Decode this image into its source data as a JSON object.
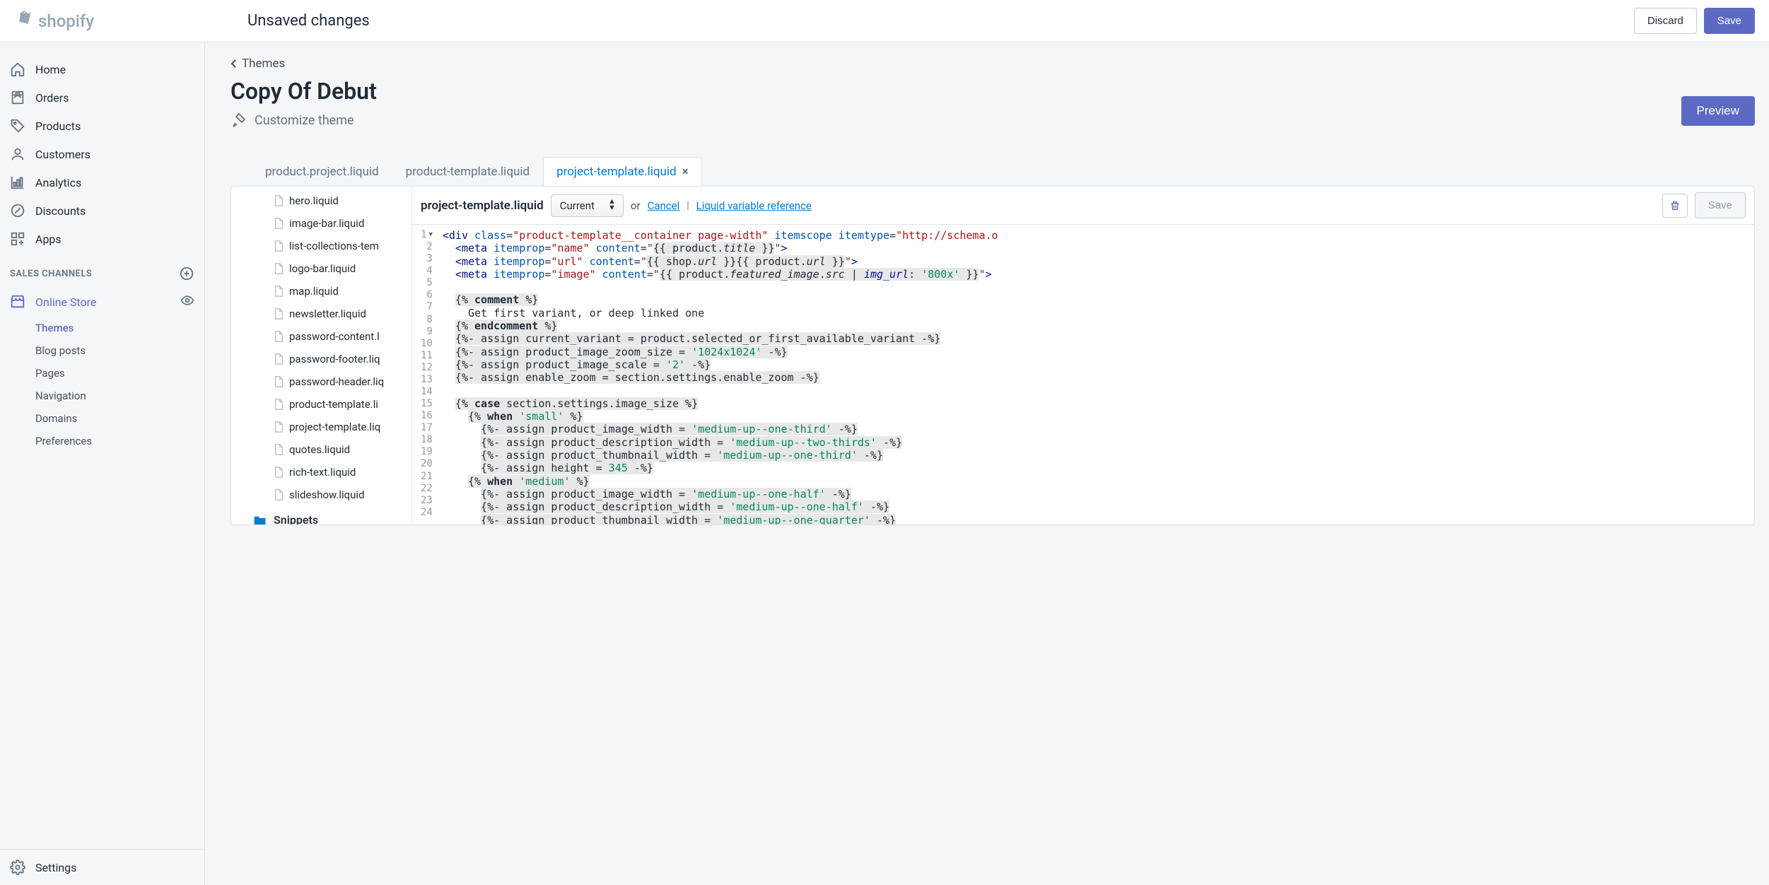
{
  "brand": "shopify",
  "topbar": {
    "unsaved": "Unsaved changes",
    "discard": "Discard",
    "save": "Save"
  },
  "nav": {
    "home": "Home",
    "orders": "Orders",
    "products": "Products",
    "customers": "Customers",
    "analytics": "Analytics",
    "discounts": "Discounts",
    "apps": "Apps",
    "section": "SALES CHANNELS",
    "online_store": "Online Store",
    "themes": "Themes",
    "blog": "Blog posts",
    "pages": "Pages",
    "navigation": "Navigation",
    "domains": "Domains",
    "preferences": "Preferences",
    "settings": "Settings"
  },
  "page": {
    "breadcrumb": "Themes",
    "title": "Copy Of Debut",
    "customize": "Customize theme",
    "preview": "Preview"
  },
  "tabs": [
    {
      "label": "product.project.liquid",
      "active": false
    },
    {
      "label": "product-template.liquid",
      "active": false
    },
    {
      "label": "project-template.liquid",
      "active": true
    }
  ],
  "files": [
    "hero.liquid",
    "image-bar.liquid",
    "list-collections-tem",
    "logo-bar.liquid",
    "map.liquid",
    "newsletter.liquid",
    "password-content.l",
    "password-footer.liq",
    "password-header.liq",
    "product-template.li",
    "project-template.liq",
    "quotes.liquid",
    "rich-text.liquid",
    "slideshow.liquid"
  ],
  "folder": "Snippets",
  "editor": {
    "filename": "project-template.liquid",
    "select": "Current",
    "or": "or",
    "cancel": "Cancel",
    "liquid_ref": "Liquid variable reference",
    "save": "Save"
  },
  "code": {
    "lines": 24
  }
}
